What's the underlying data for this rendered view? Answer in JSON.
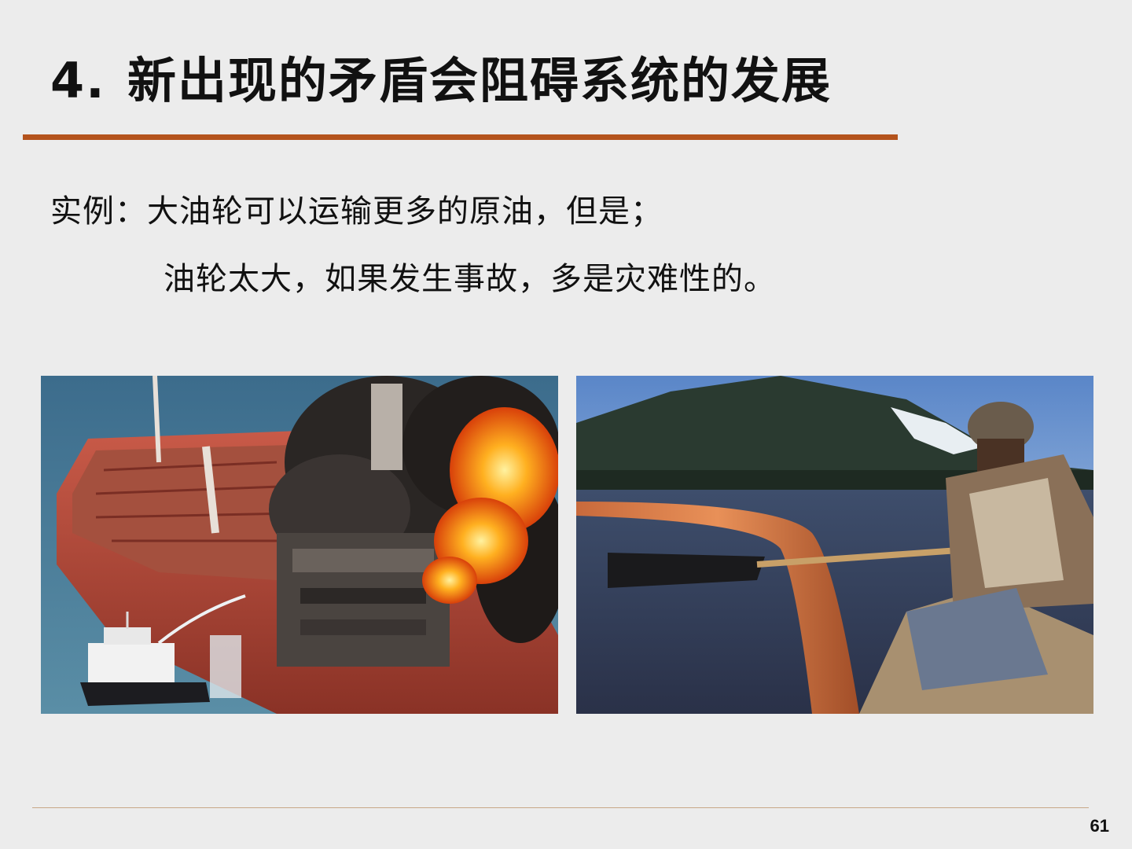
{
  "slide": {
    "title_number": "4.",
    "title_text": "新出现的矛盾会阻碍系统的发展",
    "body_line_1": "实例：大油轮可以运输更多的原油，但是；",
    "body_line_2": "油轮太大，如果发生事故，多是灾难性的。",
    "page_number": "61"
  },
  "colors": {
    "title_rule": "#b4531c",
    "background": "#ececec"
  }
}
